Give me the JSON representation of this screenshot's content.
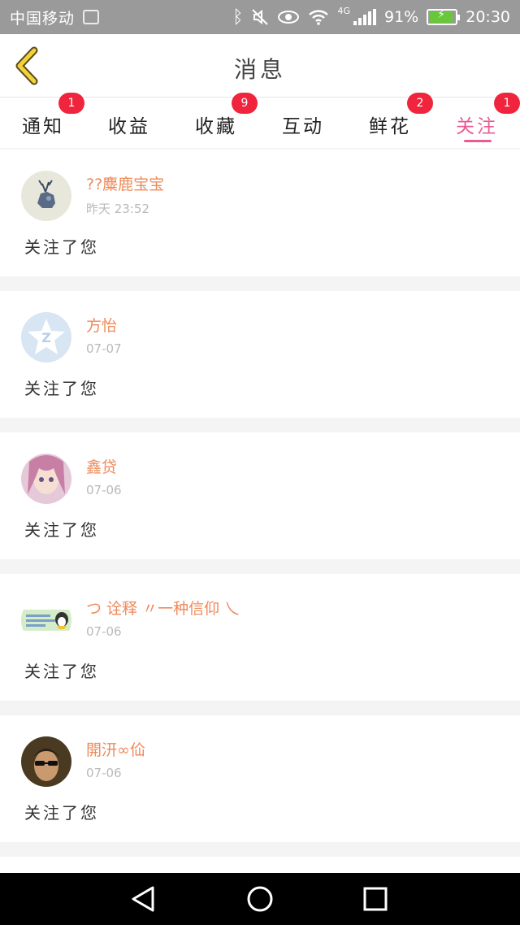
{
  "status_bar": {
    "carrier": "中国移动",
    "network": "4G",
    "battery": "91%",
    "time": "20:30"
  },
  "header": {
    "title": "消息"
  },
  "tabs": [
    {
      "label": "通知",
      "badge": "1"
    },
    {
      "label": "收益",
      "badge": ""
    },
    {
      "label": "收藏",
      "badge": "9"
    },
    {
      "label": "互动",
      "badge": ""
    },
    {
      "label": "鲜花",
      "badge": "2"
    },
    {
      "label": "关注",
      "badge": "1",
      "active": true
    }
  ],
  "messages": [
    {
      "name": "??麋鹿宝宝",
      "time": "昨天 23:52",
      "action": "关注了您",
      "avatar": "deer-avatar"
    },
    {
      "name": "方怡",
      "time": "07-07",
      "action": "关注了您",
      "avatar": "default-avatar"
    },
    {
      "name": "鑫贷",
      "time": "07-06",
      "action": "关注了您",
      "avatar": "anime-girl-avatar"
    },
    {
      "name": "つ 诠释 〃一种信仰 乀",
      "time": "07-06",
      "action": "关注了您",
      "avatar": "qq-banner-avatar"
    },
    {
      "name": "開汧∞佡",
      "time": "07-06",
      "action": "关注了您",
      "avatar": "photo-avatar"
    }
  ],
  "colors": {
    "accent": "#e85c94",
    "badge": "#f0243c",
    "username": "#ee8a5a",
    "back_arrow": "#f2d23a"
  }
}
